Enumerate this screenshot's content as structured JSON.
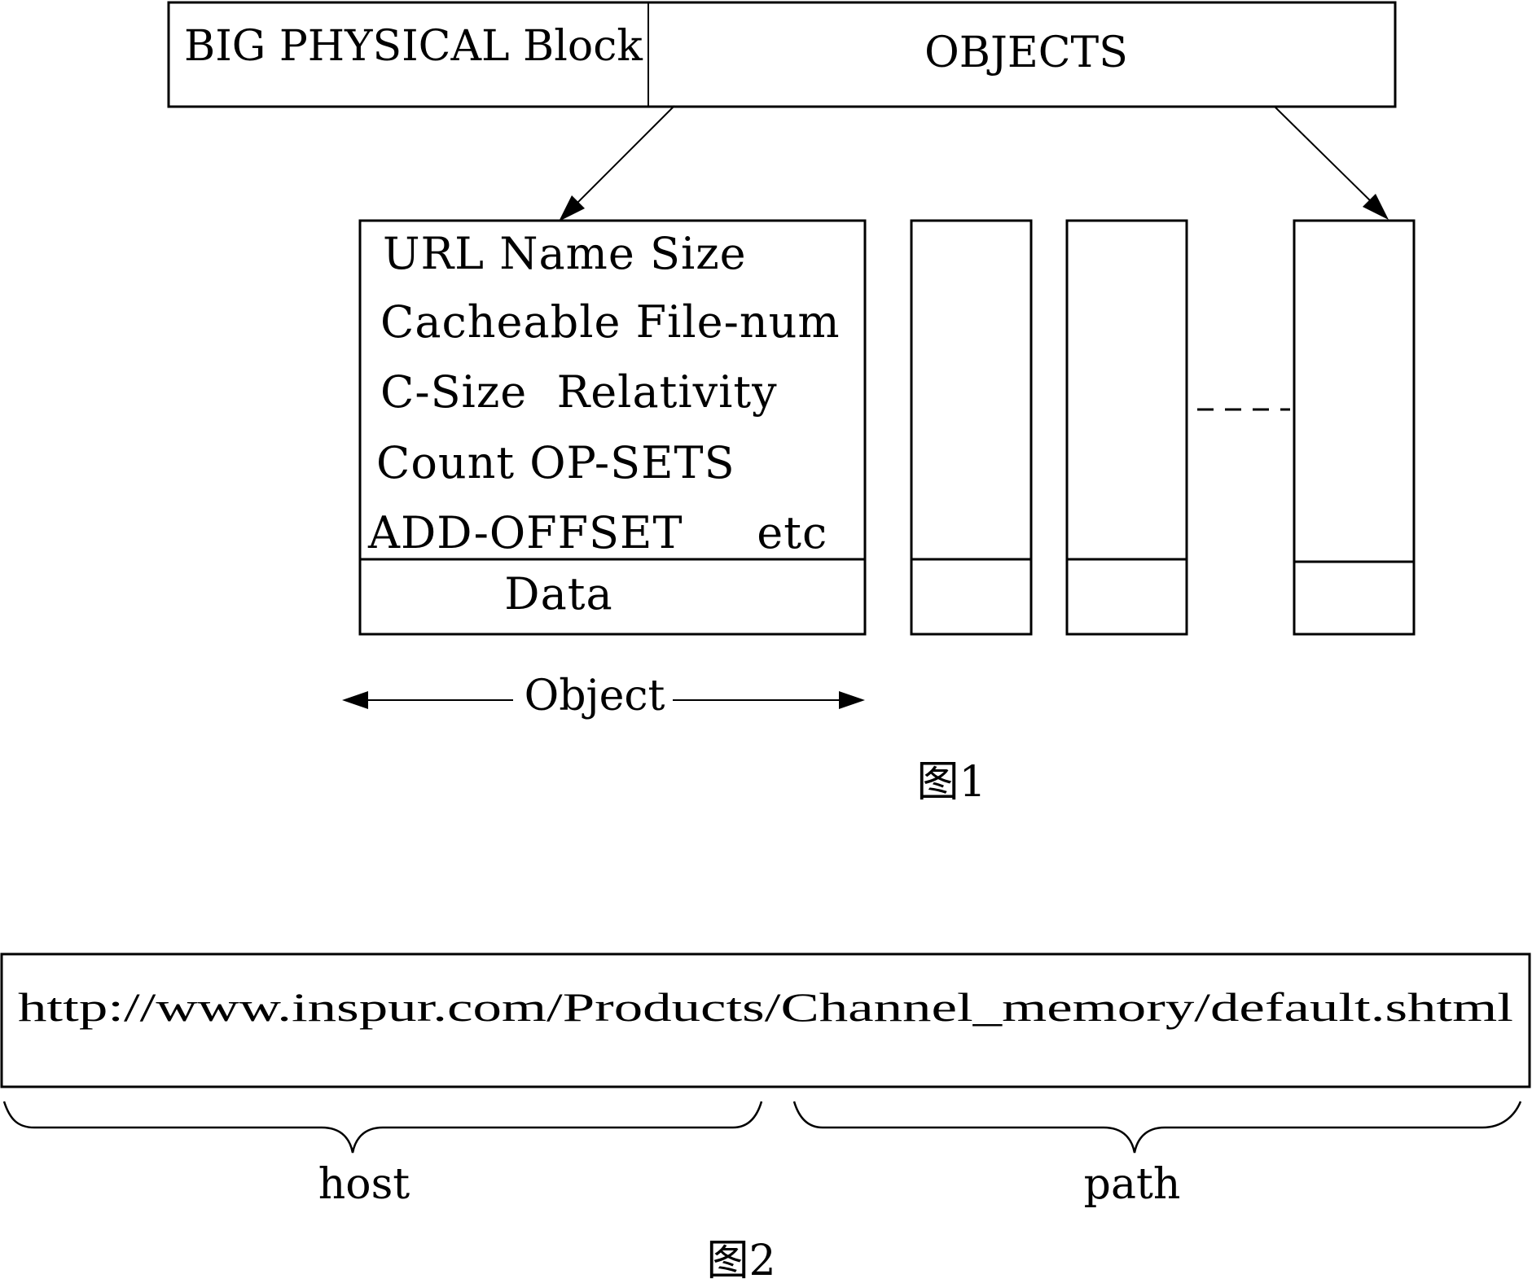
{
  "figure1": {
    "caption": "图1",
    "top_block": {
      "left_label": "BIG PHYSICAL Block",
      "right_label": "OBJECTS"
    },
    "object_box": {
      "fields": [
        "URL Name Size",
        "Cacheable File-num",
        "C-Size  Relativity",
        "Count OP-SETS",
        "ADD-OFFSET     etc"
      ],
      "data_label": "Data"
    },
    "additional_object_columns": 3,
    "ellipsis": "- - - -",
    "span_label": "Object"
  },
  "figure2": {
    "caption": "图2",
    "url": "http://www.inspur.com/Products/Channel_memory/default.shtml",
    "host_label": "host",
    "path_label": "path"
  }
}
